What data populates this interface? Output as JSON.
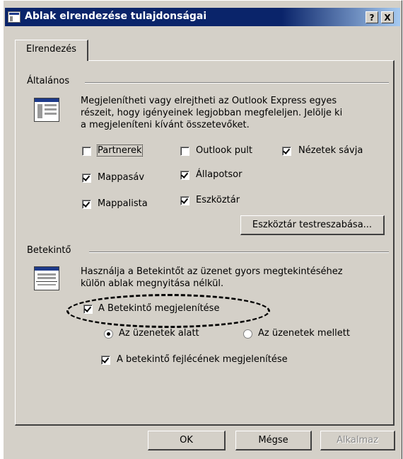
{
  "window": {
    "title": "Ablak elrendezése tulajdonságai",
    "help_btn": "?",
    "close_btn": "X"
  },
  "tabs": [
    {
      "label": "Elrendezés"
    }
  ],
  "general": {
    "title": "Általános",
    "desc": [
      "Megjelenítheti vagy elrejtheti az Outlook Express egyes",
      "részeit, hogy igényeinek legjobban megfeleljen. Jelölje ki",
      "a megjeleníteni kívánt összetevőket."
    ],
    "checkboxes": [
      {
        "label": "Partnerek",
        "checked": false
      },
      {
        "label": "Outlook pult",
        "checked": false
      },
      {
        "label": "Nézetek sávja",
        "checked": true
      },
      {
        "label": "Mappasáv",
        "checked": true
      },
      {
        "label": "Állapotsor",
        "checked": true
      },
      {
        "label": "Mappalista",
        "checked": true
      },
      {
        "label": "Eszköztár",
        "checked": true
      }
    ],
    "customize_button": "Eszköztár testreszabása..."
  },
  "preview": {
    "title": "Betekintő",
    "desc": [
      "Használja a Betekintőt az üzenet gyors megtekintéséhez",
      "külön ablak megnyitása nélkül."
    ],
    "show_checkbox": {
      "label": "A Betekintő megjelenítése",
      "checked": true
    },
    "radios": [
      {
        "label": "Az üzenetek alatt",
        "selected": true
      },
      {
        "label": "Az üzenetek mellett",
        "selected": false
      }
    ],
    "header_checkbox": {
      "label": "A betekintő fejlécének megjelenítése",
      "checked": true
    }
  },
  "buttons": {
    "ok": "OK",
    "cancel": "Mégse",
    "apply": "Alkalmaz"
  },
  "colors": {
    "titlebar": "#0a246a",
    "face": "#d4d0c8"
  }
}
